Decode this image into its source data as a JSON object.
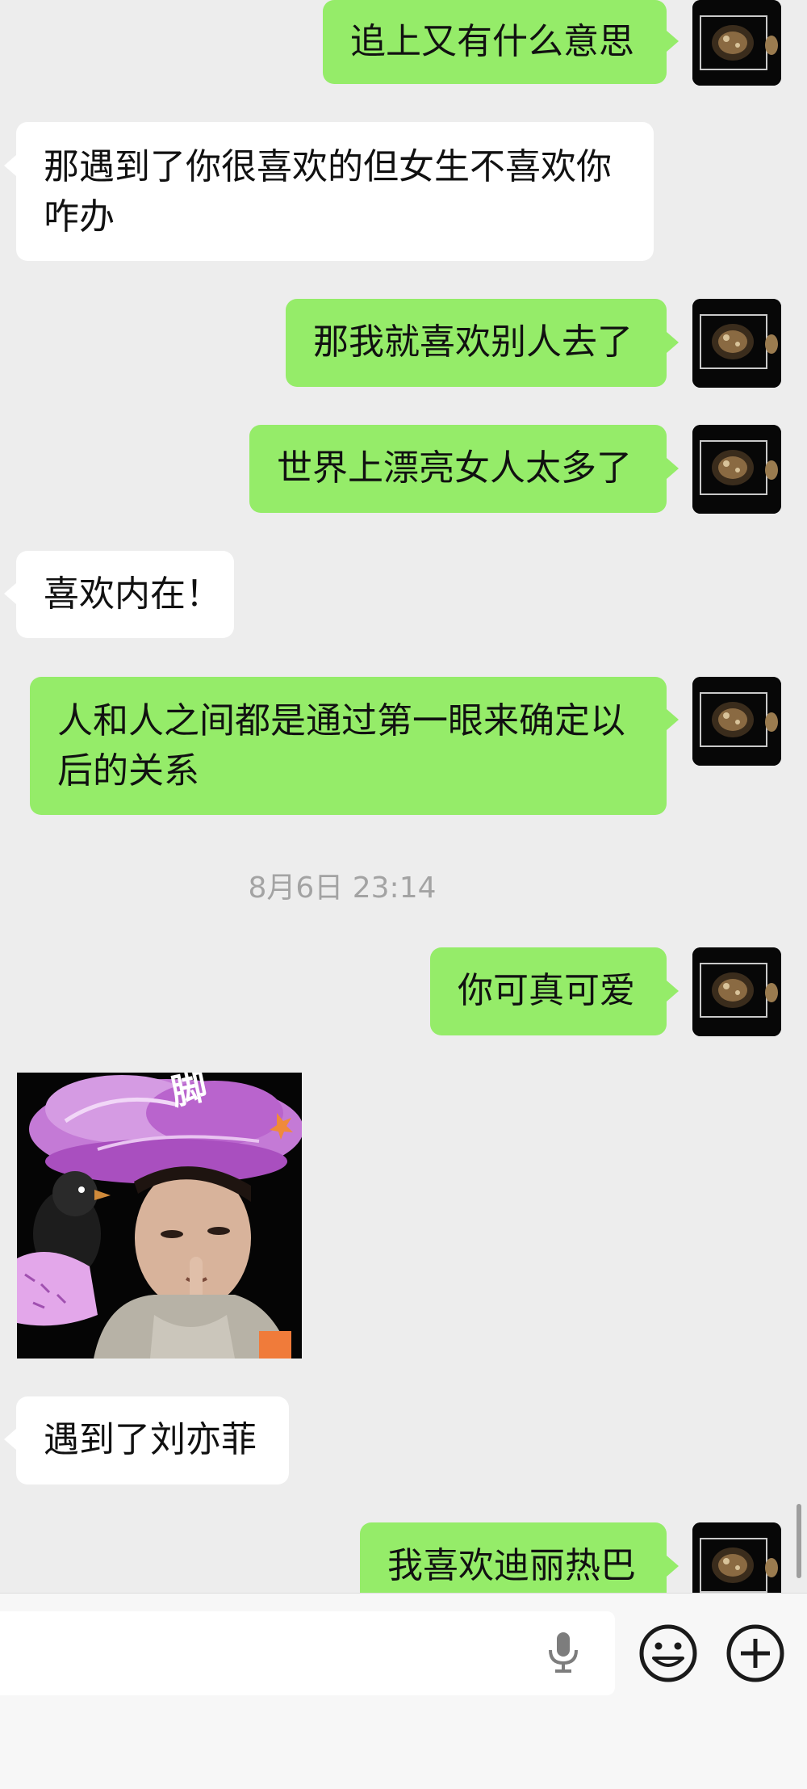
{
  "colors": {
    "background": "#ededed",
    "outgoing_bubble": "#95ec69",
    "incoming_bubble": "#ffffff",
    "timestamp": "#a3a3a3"
  },
  "messages": [
    {
      "side": "out",
      "lines": [
        "追上又有什么意思"
      ]
    },
    {
      "side": "in",
      "lines": [
        "那遇到了你很喜欢的但女生不喜欢你",
        "咋办"
      ]
    },
    {
      "side": "out",
      "lines": [
        "那我就喜欢别人去了"
      ]
    },
    {
      "side": "out",
      "lines": [
        "世界上漂亮女人太多了"
      ]
    },
    {
      "side": "in",
      "lines": [
        "喜欢内在！"
      ]
    },
    {
      "side": "out",
      "lines": [
        "人和人之间都是通过第一眼来确定以",
        "后的关系"
      ]
    },
    {
      "side": "out",
      "lines": [
        "你可真可爱"
      ]
    },
    {
      "side": "in",
      "type": "sticker",
      "icon": "sticker-image",
      "text": "脚"
    },
    {
      "side": "in",
      "lines": [
        "遇到了刘亦菲"
      ]
    },
    {
      "side": "out",
      "lines": [
        "我喜欢迪丽热巴"
      ]
    }
  ],
  "timestamp": "8月6日 23:14",
  "input_bar": {
    "icons": [
      "microphone-icon",
      "emoji-icon",
      "plus-icon"
    ]
  }
}
